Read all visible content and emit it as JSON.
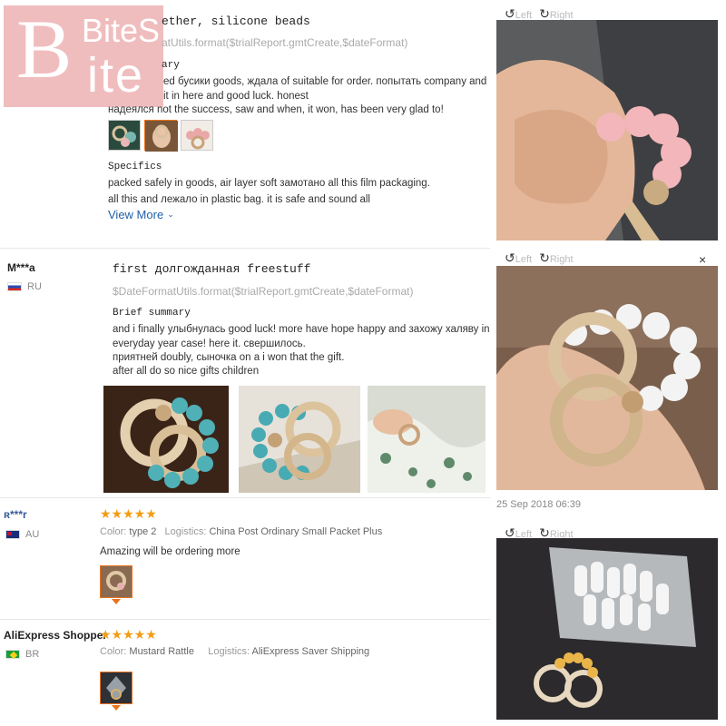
{
  "logo": {
    "big_letter": "B",
    "word_top": "BiteS",
    "word_bottom": "ite"
  },
  "review1": {
    "title": "ether, silicone beads",
    "date_template": "atUtils.format($trialReport.gmtCreate,$dateFormat)",
    "summary_label": "ary",
    "summary_lines": [
      "ed бусики goods, ждала of suitable for order. попытать company and",
      "it in here and good luck. honest",
      "надеялся not the success, saw and when, it won, has been very glad to!"
    ],
    "specifics_label": "Specifics",
    "specifics_lines": [
      "packed safely in goods, air layer soft замотано all this film packaging.",
      "all this and лежало in plastic bag. it is safe and sound all"
    ],
    "view_more": "View More",
    "view_more_icon": "chevron-down-icon"
  },
  "review2": {
    "user": "M***a",
    "country": "RU",
    "title": "first долгожданная freestuff",
    "date_template": "$DateFormatUtils.format($trialReport.gmtCreate,$dateFormat)",
    "summary_label": "Brief summary",
    "summary_lines": [
      "and i finally улыбнулась good luck! more have hope happy and захожу халяву in",
      "everyday year case! here it. свершилось.",
      "приятней doubly, сыночка on a i won that the gift.",
      "after all do so nice gifts children"
    ]
  },
  "review3": {
    "user": "ʀ***r",
    "country": "AU",
    "stars": "★★★★★",
    "color_label": "Color:",
    "color_value": "type 2",
    "logistics_label": "Logistics:",
    "logistics_value": "China Post Ordinary Small Packet Plus",
    "text": "Amazing will be ordering more"
  },
  "review4": {
    "user": "AliExpress Shopper",
    "country": "BR",
    "stars": "★★★★★",
    "color_label": "Color:",
    "color_value": "Mustard Rattle",
    "logistics_label": "Logistics:",
    "logistics_value": "AliExpress Saver Shipping"
  },
  "viewer": {
    "left_label": "Left",
    "right_label": "Right",
    "close_symbol": "×",
    "timestamp": "25 Sep 2018 06:39"
  },
  "colors": {
    "accent": "#e8731e",
    "link": "#1f5fa8",
    "star": "#f39c12",
    "logo_bg": "#eca9ab"
  }
}
